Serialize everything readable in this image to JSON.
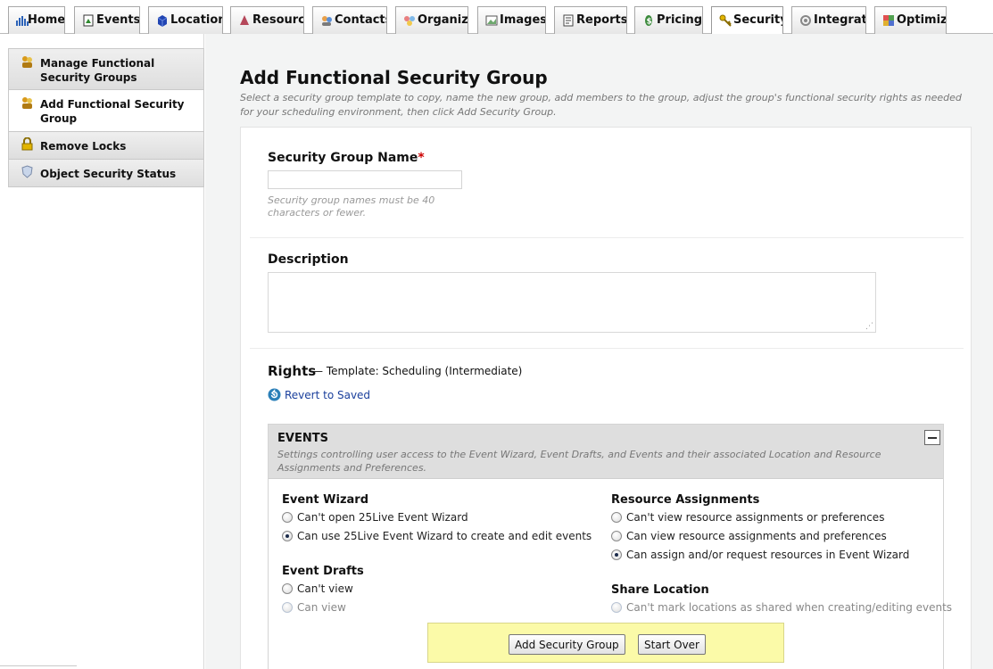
{
  "tabs": [
    {
      "label": "Home",
      "icon": "home-icon",
      "active": false
    },
    {
      "label": "Events",
      "icon": "events-icon",
      "active": false
    },
    {
      "label": "Locations",
      "icon": "locations-icon",
      "active": false
    },
    {
      "label": "Resources",
      "icon": "resources-icon",
      "active": false
    },
    {
      "label": "Contacts",
      "icon": "contacts-icon",
      "active": false
    },
    {
      "label": "Organizations",
      "icon": "organizations-icon",
      "active": false
    },
    {
      "label": "Images",
      "icon": "images-icon",
      "active": false
    },
    {
      "label": "Reports",
      "icon": "reports-icon",
      "active": false
    },
    {
      "label": "Pricing",
      "icon": "pricing-icon",
      "active": false
    },
    {
      "label": "Security",
      "icon": "key-icon",
      "active": true
    },
    {
      "label": "Integrations",
      "icon": "integrations-icon",
      "active": false
    },
    {
      "label": "Optimizer",
      "icon": "optimizer-icon",
      "active": false
    }
  ],
  "sidebar": {
    "items": [
      {
        "label": "Manage Functional Security Groups",
        "icon": "security-groups-icon",
        "active": false
      },
      {
        "label": "Add Functional Security Group",
        "icon": "security-groups-icon",
        "active": true
      },
      {
        "label": "Remove Locks",
        "icon": "lock-icon",
        "active": false
      },
      {
        "label": "Object Security Status",
        "icon": "shield-icon",
        "active": false
      }
    ]
  },
  "page": {
    "title": "Add Functional Security Group",
    "description": "Select a security group template to copy, name the new group, add members to the group, adjust the group's functional security rights as needed for your scheduling environment, then click Add Security Group."
  },
  "form": {
    "name_label": "Security Group Name",
    "required_mark": "*",
    "name_value": "",
    "name_hint": "Security group names must be 40 characters or fewer.",
    "description_label": "Description",
    "description_value": "",
    "rights_label": "Rights",
    "rights_template": "— Template: Scheduling (Intermediate)",
    "revert_label": "Revert to Saved"
  },
  "events_section": {
    "title": "EVENTS",
    "description": "Settings controlling user access to the Event Wizard, Event Drafts, and Events and their associated Location and Resource Assignments and Preferences.",
    "groups": {
      "event_wizard": {
        "title": "Event Wizard",
        "options": [
          {
            "label": "Can't open 25Live Event Wizard",
            "selected": false
          },
          {
            "label": "Can use 25Live Event Wizard to create and edit events",
            "selected": true
          }
        ]
      },
      "event_drafts": {
        "title": "Event Drafts",
        "options": [
          {
            "label": "Can't view",
            "selected": false
          },
          {
            "label": "Can view",
            "selected": false
          }
        ]
      },
      "resource_assignments": {
        "title": "Resource Assignments",
        "options": [
          {
            "label": "Can't view resource assignments or preferences",
            "selected": false
          },
          {
            "label": "Can view resource assignments and preferences",
            "selected": false
          },
          {
            "label": "Can assign and/or request resources in Event Wizard",
            "selected": true
          }
        ]
      },
      "share_location": {
        "title": "Share Location",
        "options": [
          {
            "label": "Can't mark locations as shared when creating/editing events",
            "selected": false
          }
        ]
      }
    }
  },
  "actions": {
    "add_label": "Add Security Group",
    "start_over_label": "Start Over"
  },
  "colors": {
    "action_bar": "#fbfaa8",
    "section_header": "#dedede",
    "link": "#1a3f9c",
    "required": "#cc0000"
  }
}
